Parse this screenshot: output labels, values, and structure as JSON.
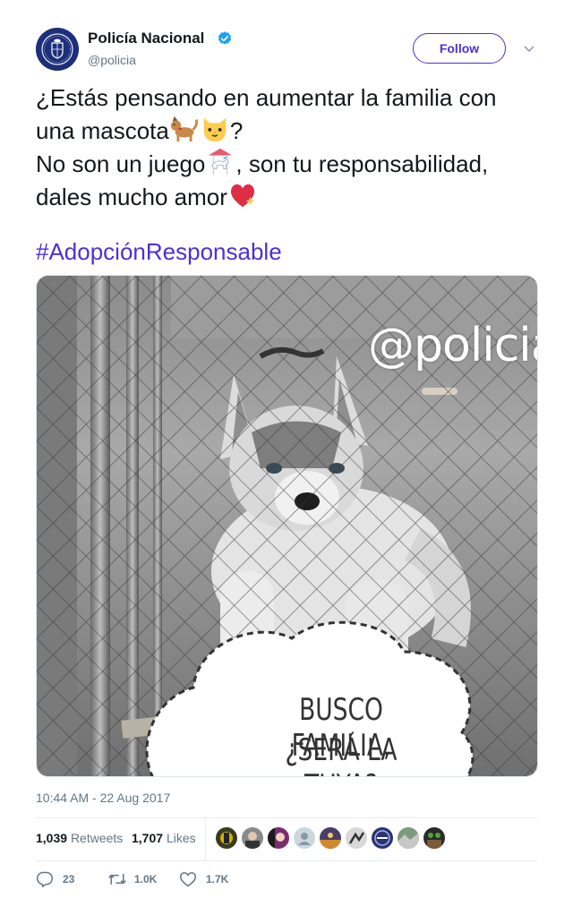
{
  "author": {
    "display_name": "Policía Nacional",
    "handle": "@policia",
    "verified_icon": "verified-badge-icon",
    "avatar_icon": "police-crest-avatar"
  },
  "follow_label": "Follow",
  "menu_icon": "chevron-down-icon",
  "tweet": {
    "line1": "¿Estás pensando en aumentar la familia con",
    "line2_text": "una mascota",
    "line2_after": "?",
    "line3_text": "No son un juego",
    "line3_after": ", son tu responsabilidad,",
    "line4_text": "dales mucho amor",
    "hashtag": "#AdopciónResponsable",
    "emojis": [
      "dog-emoji",
      "cat-face-emoji",
      "carousel-horse-emoji",
      "sparkling-heart-emoji"
    ]
  },
  "media": {
    "watermark": "@policia",
    "bubble_line1": "BUSCO FAMILIA,",
    "bubble_line2": "¿SERÁ LA TUYA?",
    "subject": "husky-puppy-behind-fence-photo"
  },
  "timestamp": "10:44 AM - 22 Aug 2017",
  "stats": {
    "retweets_count": "1,039",
    "retweets_label": "Retweets",
    "likes_count": "1,707",
    "likes_label": "Likes"
  },
  "actions": {
    "reply_count": "23",
    "retweet_count": "1.0K",
    "like_count": "1.7K"
  },
  "colors": {
    "link": "#4a31d8",
    "verified": "#1da1f2",
    "secondary_text": "#657786",
    "avatar_bg": "#1d2f7a"
  }
}
